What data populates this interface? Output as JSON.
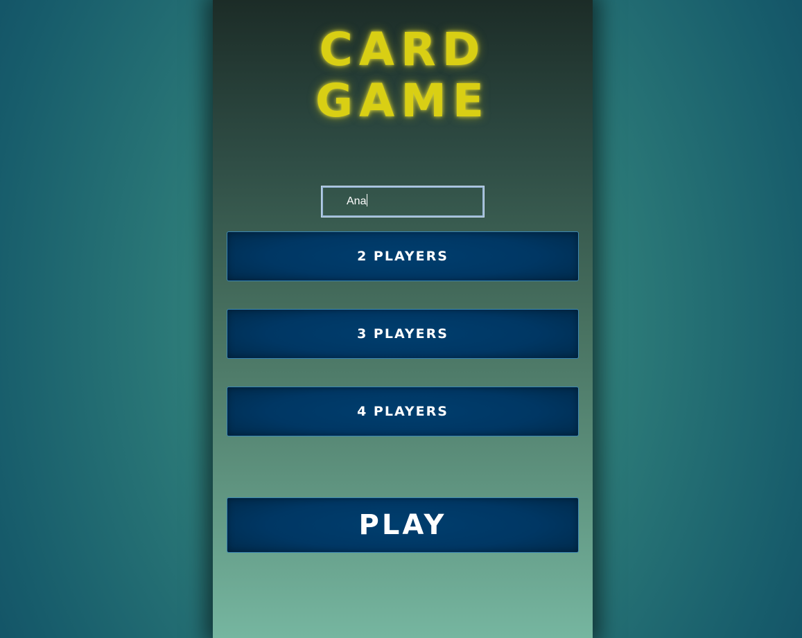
{
  "title": {
    "line1": "CARD",
    "line2": "GAME"
  },
  "name_input": {
    "value": "Ana"
  },
  "buttons": {
    "two_players": "2 PLAYERS",
    "three_players": "3 PLAYERS",
    "four_players": "4 PLAYERS",
    "play": "PLAY"
  },
  "colors": {
    "title": "#d9cf14",
    "button_bg": "#003e6e",
    "button_border": "#3b88b5",
    "input_border": "#9ab8d6"
  }
}
